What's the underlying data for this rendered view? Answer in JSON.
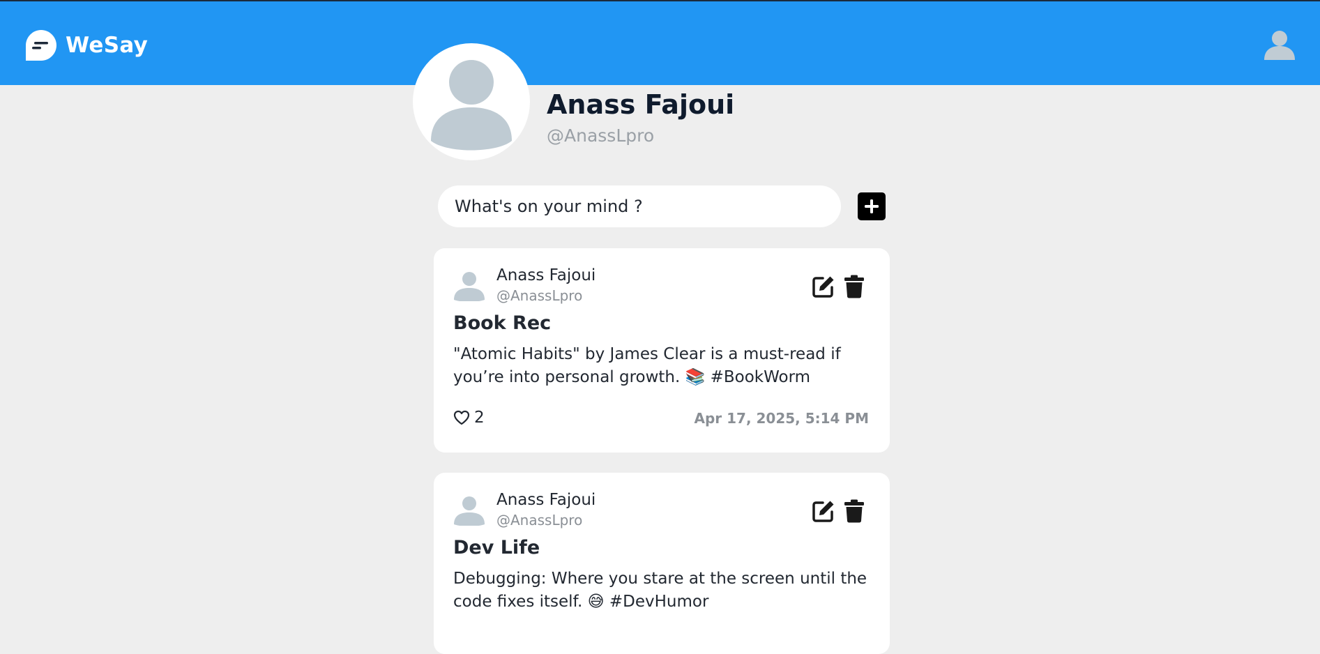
{
  "app": {
    "name": "WeSay",
    "brand_color": "#2196f3"
  },
  "profile": {
    "name": "Anass Fajoui",
    "handle": "@AnassLpro"
  },
  "composer": {
    "placeholder": "What's on your mind ?",
    "add_icon": "plus-icon"
  },
  "posts": [
    {
      "author": "Anass Fajoui",
      "handle": "@AnassLpro",
      "title": "Book Rec",
      "body": "\"Atomic Habits\" by James Clear is a must-read if you’re into personal growth. 📚 #BookWorm",
      "likes": "2",
      "timestamp": "Apr 17, 2025, 5:14 PM"
    },
    {
      "author": "Anass Fajoui",
      "handle": "@AnassLpro",
      "title": "Dev Life",
      "body": "Debugging: Where you stare at the screen until the code fixes itself. 😅 #DevHumor"
    }
  ],
  "icons": {
    "edit": "edit-icon",
    "delete": "trash-icon",
    "like": "heart-icon",
    "avatar": "user-avatar-icon"
  }
}
